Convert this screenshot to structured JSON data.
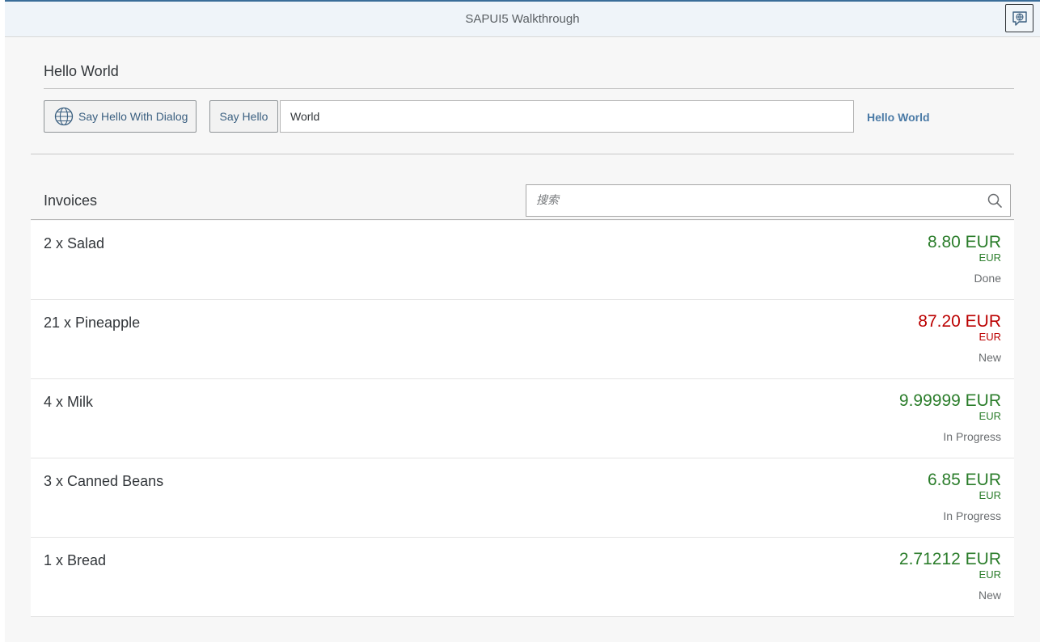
{
  "shell": {
    "title": "SAPUI5 Walkthrough",
    "header_icon": "feedback-icon"
  },
  "panel": {
    "title": "Hello World",
    "dialog_button_label": "Say Hello With Dialog",
    "dialog_button_icon": "globe-icon",
    "hello_button_label": "Say Hello",
    "name_input_value": "World",
    "greeting_text": "Hello World"
  },
  "invoices": {
    "title": "Invoices",
    "search_placeholder": "搜索",
    "items": [
      {
        "title": "2 x Salad",
        "number": "8.80 EUR",
        "unit": "EUR",
        "status": "Done",
        "state": "success"
      },
      {
        "title": "21 x Pineapple",
        "number": "87.20 EUR",
        "unit": "EUR",
        "status": "New",
        "state": "error"
      },
      {
        "title": "4 x Milk",
        "number": "9.99999 EUR",
        "unit": "EUR",
        "status": "In Progress",
        "state": "success"
      },
      {
        "title": "3 x Canned Beans",
        "number": "6.85 EUR",
        "unit": "EUR",
        "status": "In Progress",
        "state": "success"
      },
      {
        "title": "1 x Bread",
        "number": "2.71212 EUR",
        "unit": "EUR",
        "status": "New",
        "state": "success"
      }
    ]
  },
  "colors": {
    "success": "#2b7d2b",
    "error": "#bb0000",
    "link": "#4a7aa6",
    "shell_accent": "#3a6d99"
  }
}
